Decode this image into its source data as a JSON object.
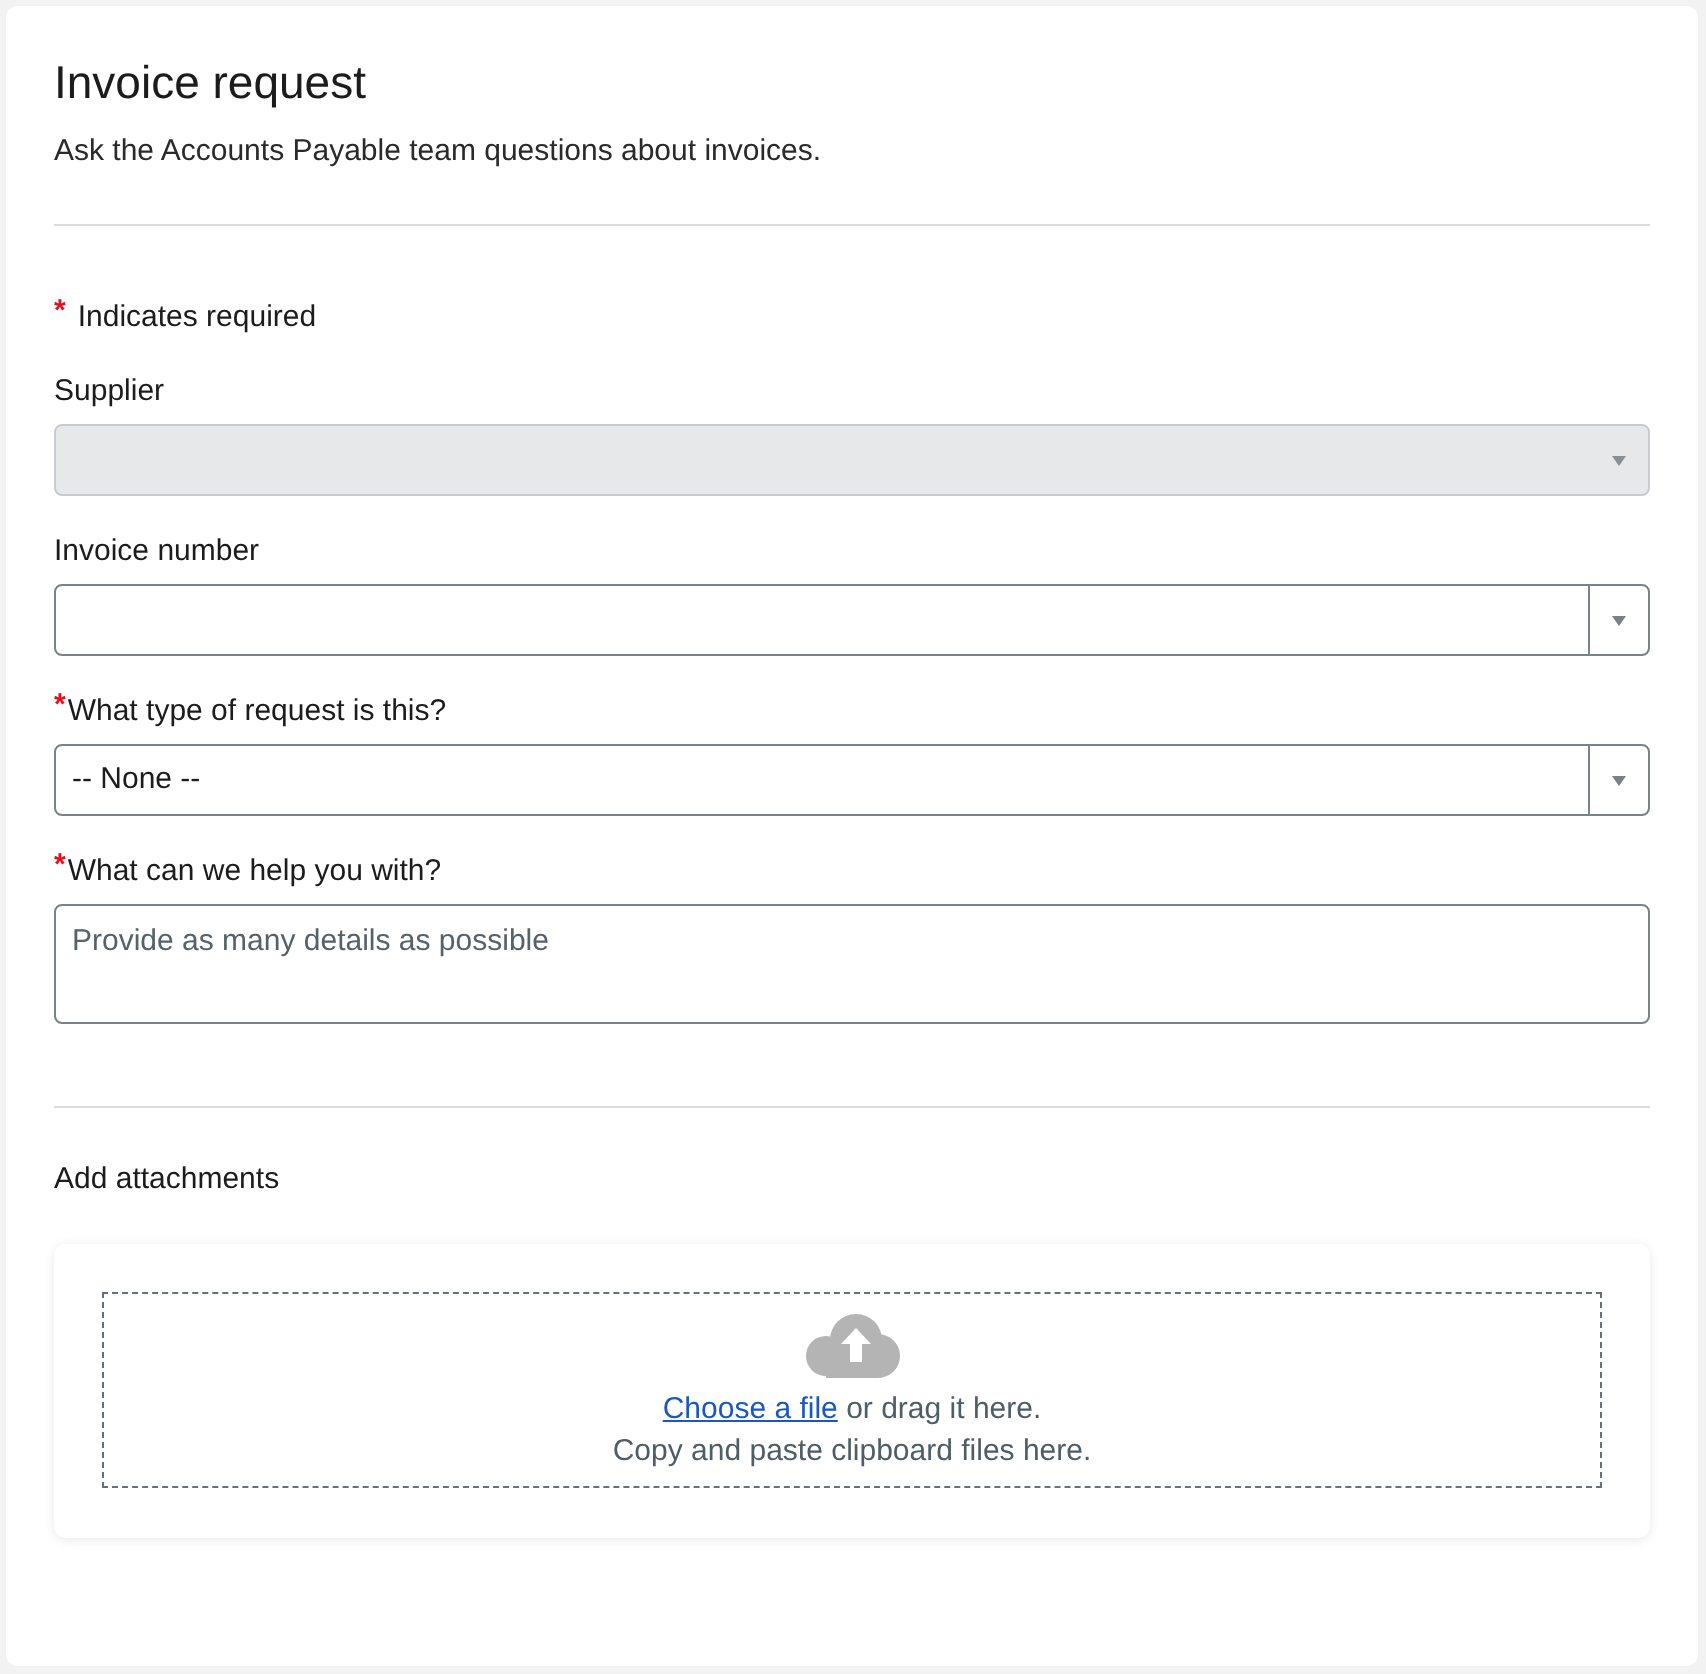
{
  "form": {
    "title": "Invoice request",
    "description": "Ask the Accounts Payable team questions about invoices.",
    "required_note": {
      "mark": "*",
      "text": "Indicates required"
    },
    "fields": [
      {
        "kind": "select",
        "label": "Supplier",
        "disabled": true
      },
      {
        "kind": "select",
        "label": "Invoice number",
        "disabled": false
      },
      {
        "kind": "select",
        "label": "What type of request is this?",
        "required_mark": "*",
        "disabled": false,
        "value": "-- None --"
      },
      {
        "kind": "textarea",
        "label": "What can we help you with?",
        "required_mark": "*",
        "disabled": false,
        "placeholder": "Provide as many details as possible"
      }
    ]
  },
  "attachments": {
    "label": "Add attachments",
    "link": "Choose a file",
    "link_suffix": "or drag it here.",
    "hint": "Copy and paste clipboard files here."
  }
}
